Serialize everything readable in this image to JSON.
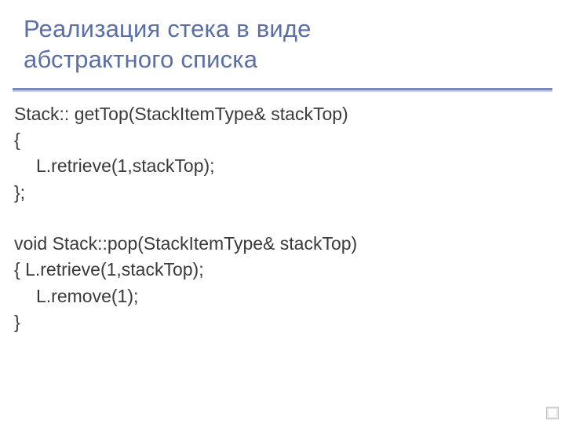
{
  "title_line1": "Реализация стека в виде",
  "title_line2": "абстрактного списка",
  "code": {
    "l1": "Stack:: getTop(StackItemType& stackTop)",
    "l2": "{",
    "l3": "L.retrieve(1,stackTop);",
    "l4": "};",
    "l5": "void Stack::pop(StackItemType& stackTop)",
    "l6": "{ L.retrieve(1,stackTop);",
    "l7": "L.remove(1);",
    "l8": "}"
  }
}
